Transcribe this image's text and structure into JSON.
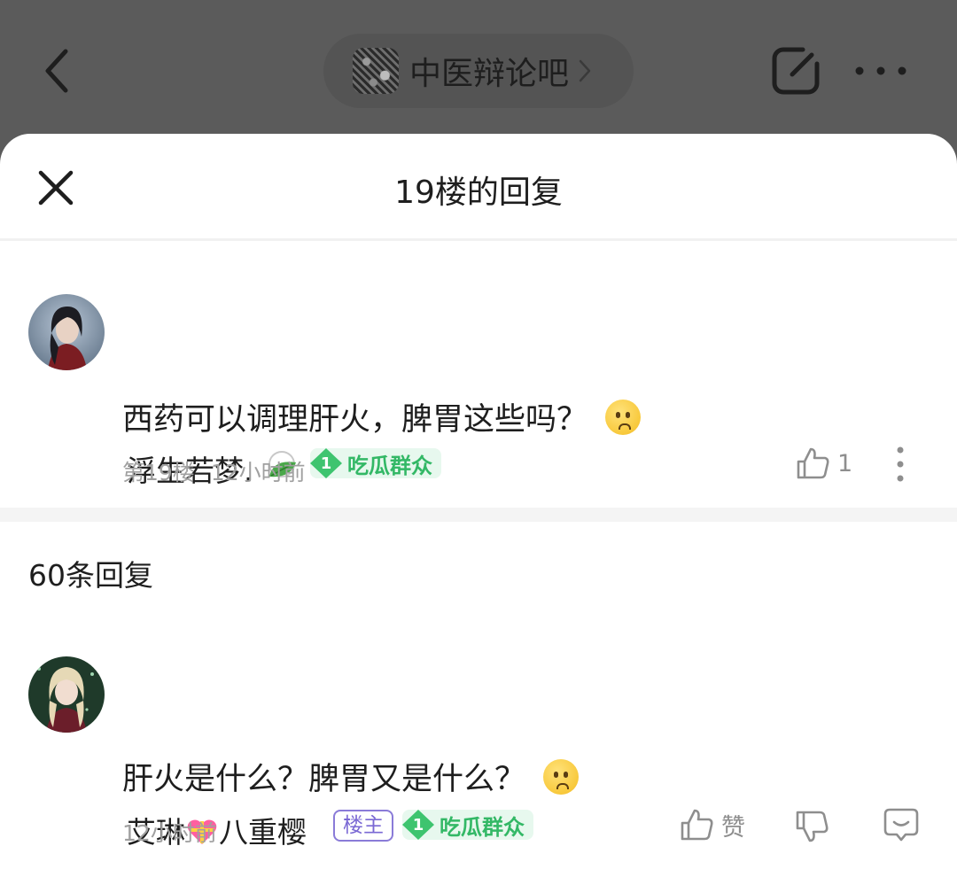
{
  "topbar": {
    "forum_name": "中医辩论吧"
  },
  "sheet": {
    "title": "19楼的回复"
  },
  "floor_post": {
    "username": "浮生若梦.",
    "level_num": "1",
    "level_title": "吃瓜群众",
    "like_count": "1",
    "text": "西药可以调理肝火，脾胃这些吗？",
    "floor_label": "第19楼",
    "time": "12小时前"
  },
  "replies": {
    "count_label": "60条回复",
    "items": [
      {
        "username_part1": "艾琳",
        "username_part2": "八重樱",
        "owner_badge": "楼主",
        "level_num": "1",
        "level_title": "吃瓜群众",
        "like_label": "赞",
        "text": "肝火是什么？脾胃又是什么？",
        "time": "12小时前"
      }
    ]
  },
  "colors": {
    "overlay": "#5b5b5b",
    "level_green": "#3ec46f",
    "owner_purple": "#7a68d4"
  }
}
